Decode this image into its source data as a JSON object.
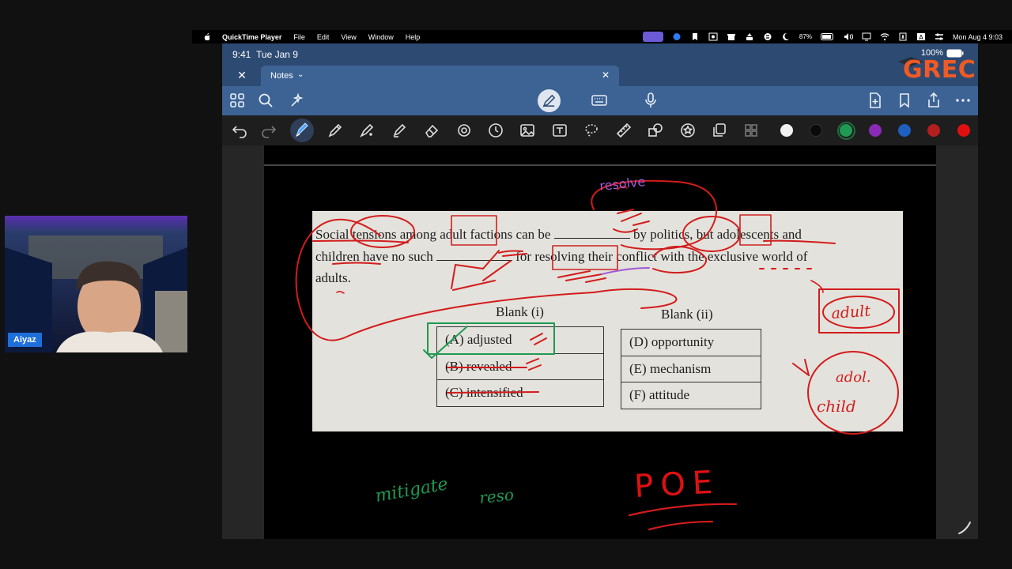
{
  "menubar": {
    "app_name": "QuickTime Player",
    "menus": [
      "File",
      "Edit",
      "View",
      "Window",
      "Help"
    ],
    "battery_percent": "87%",
    "clock": "Mon Aug 4  9:03",
    "icons": [
      "screen-mirror-icon",
      "zoom-icon",
      "bookmark-icon",
      "screenshot-icon",
      "gift-icon",
      "printer-icon",
      "circle-s-icon",
      "moon-icon",
      "battery-icon",
      "volume-icon",
      "display-icon",
      "wifi-icon",
      "text-input-icon",
      "user-icon",
      "control-center-icon"
    ]
  },
  "ipad": {
    "status_time": "9:41",
    "status_date": "Tue Jan 9",
    "battery": "100%",
    "tab_title": "Notes",
    "toolbar_icons": [
      "grid-icon",
      "search-icon",
      "sparkle-icon",
      "pen-mode-icon",
      "keyboard-icon",
      "microphone-icon",
      "add-page-icon",
      "bookmark-icon",
      "share-icon",
      "more-icon"
    ],
    "drawing_tools": [
      "undo-icon",
      "redo-icon",
      "fountain-pen-icon",
      "pencil-icon",
      "brush-icon",
      "highlighter-icon",
      "eraser-icon",
      "laser-pointer-icon",
      "timer-icon",
      "image-icon",
      "text-box-icon",
      "lasso-icon",
      "ruler-icon",
      "shapes-icon",
      "sticker-icon",
      "copy-icon",
      "more-tools-icon"
    ],
    "colors": [
      "#f2f2f2",
      "#0a0a0a",
      "#1f9a52",
      "#8a2ab8",
      "#1e5fc0",
      "#b41e1e",
      "#e01010"
    ],
    "selected_color": "#1f9a52"
  },
  "question": {
    "line1a": "Social tensions among adult factions can be",
    "line1b": "by politics, but adolescents and",
    "line2a": "children have no such",
    "line2b": "for resolving their conflict with the exclusive world of",
    "line3": "adults.",
    "blank1_header": "Blank (i)",
    "blank2_header": "Blank (ii)",
    "blank1_options": [
      "(A) adjusted",
      "(B) revealed",
      "(C) intensified"
    ],
    "blank2_options": [
      "(D) opportunity",
      "(E) mechanism",
      "(F) attitude"
    ]
  },
  "handwriting": {
    "top_note": "resolve",
    "box_note": "adult",
    "circle_note_line1": "adol.",
    "circle_note_line2": "child",
    "green_note_1": "mitigate",
    "green_note_2": "reso",
    "poe": "POE"
  },
  "webcam": {
    "name": "Aiyaz"
  },
  "logo": {
    "text": "GREC",
    "accent": "#f05a24"
  }
}
